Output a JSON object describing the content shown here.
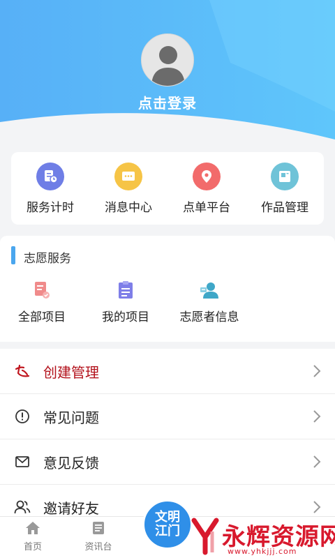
{
  "header": {
    "login_text": "点击登录"
  },
  "quick_menu": [
    {
      "label": "服务计时",
      "icon": "service-timer-icon",
      "color": "#6f7ee6"
    },
    {
      "label": "消息中心",
      "icon": "message-icon",
      "color": "#f6c446"
    },
    {
      "label": "点单平台",
      "icon": "location-pin-icon",
      "color": "#f26b6b"
    },
    {
      "label": "作品管理",
      "icon": "works-icon",
      "color": "#6fc3d8"
    }
  ],
  "volunteer": {
    "title": "志愿服务",
    "items": [
      {
        "label": "全部项目",
        "icon": "all-projects-icon"
      },
      {
        "label": "我的项目",
        "icon": "my-projects-icon"
      },
      {
        "label": "志愿者信息",
        "icon": "volunteer-info-icon"
      }
    ]
  },
  "menu_list": [
    {
      "label": "创建管理",
      "icon": "create-manage-icon"
    },
    {
      "label": "常见问题",
      "icon": "faq-icon"
    },
    {
      "label": "意见反馈",
      "icon": "feedback-icon"
    },
    {
      "label": "邀请好友",
      "icon": "invite-friends-icon"
    }
  ],
  "tabbar": {
    "home": "首页",
    "news": "资讯台",
    "center_line1": "文明",
    "center_line2": "江门"
  },
  "watermark": {
    "text": "永辉资源网",
    "url": "www.yhkjjj.com"
  },
  "colors": {
    "header_blue": "#4aa3f5",
    "accent_red": "#b3121c",
    "section_bar": "#4aa6ee"
  }
}
